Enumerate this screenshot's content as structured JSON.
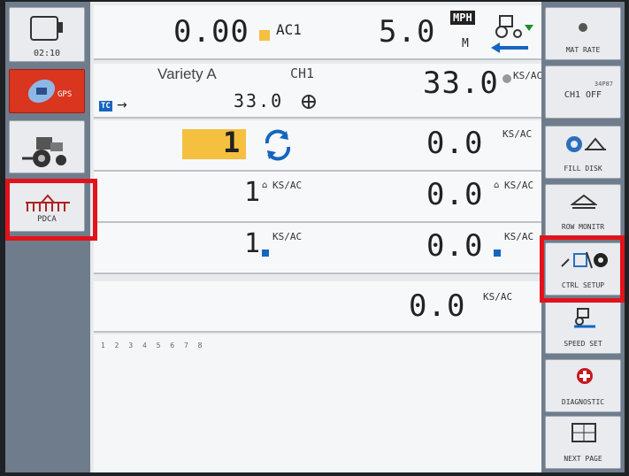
{
  "status": {
    "clock": "02:10",
    "rate": "0.00",
    "ac_label": "AC1",
    "speed": "5.0",
    "speed_unit": "MPH",
    "speed_sub": "M"
  },
  "channel": {
    "variety": "Variety A",
    "channel": "CH1",
    "target_rate": "33.0",
    "actual_rate": "33.0",
    "tc_label": "TC",
    "rate_unit": "KS/AC"
  },
  "rows": [
    {
      "left_value": "1",
      "right_value": "0.0",
      "unit": "KS/AC"
    },
    {
      "left_value": "1",
      "right_value": "0.0",
      "unit": "KS/AC"
    },
    {
      "left_value": "1",
      "right_value": "0.0",
      "unit": "KS/AC"
    },
    {
      "right_value": "0.0",
      "unit": "KS/AC"
    }
  ],
  "row_numbers": [
    "1",
    "2",
    "3",
    "4",
    "5",
    "6",
    "7",
    "8"
  ],
  "left_buttons": [
    {
      "label": "02:10",
      "icon": "monitor-icon"
    },
    {
      "label": "",
      "icon": "satellite-icon"
    },
    {
      "label": "",
      "icon": "tractor-icon"
    },
    {
      "label": "PDCA",
      "icon": "planter-icon"
    }
  ],
  "right_buttons": [
    {
      "label": "MAT RATE",
      "icon": "mat-rate-icon"
    },
    {
      "label": "CH1 OFF",
      "small_label": "34P87",
      "icon": "channel-icon"
    },
    {
      "label": "FILL DISK",
      "icon": "fill-disk-icon"
    },
    {
      "label": "ROW MONITR",
      "icon": "row-monitor-icon"
    },
    {
      "label": "CTRL SETUP",
      "icon": "ctrl-setup-icon"
    },
    {
      "label": "SPEED SET",
      "icon": "speed-set-icon"
    },
    {
      "label": "DIAGNOSTIC",
      "icon": "diagnostic-icon"
    },
    {
      "label": "NEXT PAGE",
      "icon": "next-page-icon"
    }
  ],
  "colors": {
    "highlight": "#f5c040",
    "accent_blue": "#1565c0",
    "alert_red": "#e3121b"
  }
}
